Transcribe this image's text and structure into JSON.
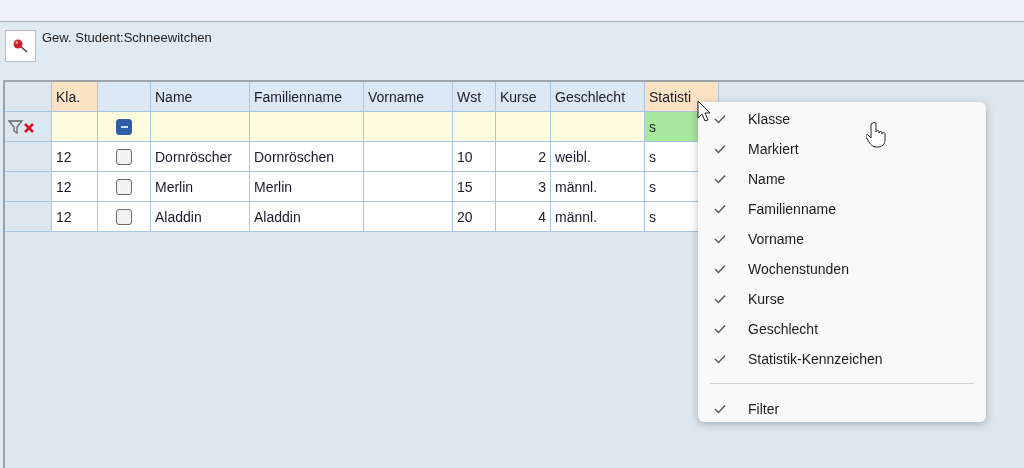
{
  "selection": {
    "label": "Gew. Student:Schneewitchen"
  },
  "table": {
    "columns": [
      {
        "label": "Kla.",
        "sorted": true
      },
      {
        "sorted": false
      },
      {
        "label": "Name",
        "sorted": false
      },
      {
        "label": "Familienname",
        "sorted": false
      },
      {
        "label": "Vorname",
        "sorted": false
      },
      {
        "label": "Wst",
        "sorted": false
      },
      {
        "label": "Kurse",
        "sorted": false
      },
      {
        "label": "Geschlecht",
        "sorted": false
      },
      {
        "label": "Statisti",
        "sorted": true
      }
    ],
    "filter_row": [
      {
        "active": false
      },
      {
        "kind": "checkbox",
        "indeterminate": true
      },
      {
        "active": false
      },
      {
        "active": false
      },
      {
        "active": false
      },
      {
        "active": false
      },
      {
        "active": false
      },
      {
        "active": false
      },
      {
        "value": "s",
        "active": true
      }
    ],
    "rows": [
      {
        "klasse": "12",
        "checked": false,
        "name": "Dornröscher",
        "familienname": "Dornröschen",
        "wst": "10",
        "kurse": "2",
        "geschlecht": "weibl.",
        "statistik": "s"
      },
      {
        "klasse": "12",
        "checked": false,
        "name": "Merlin",
        "familienname": "Merlin",
        "wst": "15",
        "kurse": "3",
        "geschlecht": "männl.",
        "statistik": "s"
      },
      {
        "klasse": "12",
        "checked": false,
        "name": "Aladdin",
        "familienname": "Aladdin",
        "wst": "20",
        "kurse": "4",
        "geschlecht": "männl.",
        "statistik": "s"
      }
    ]
  },
  "context_menu": {
    "items": [
      {
        "label": "Klasse",
        "checked": true
      },
      {
        "label": "Markiert",
        "checked": true
      },
      {
        "label": "Name",
        "checked": true
      },
      {
        "label": "Familienname",
        "checked": true
      },
      {
        "label": "Vorname",
        "checked": true
      },
      {
        "label": "Wochenstunden",
        "checked": true
      },
      {
        "label": "Kurse",
        "checked": true
      },
      {
        "label": "Geschlecht",
        "checked": true
      },
      {
        "label": "Statistik-Kennzeichen",
        "checked": true
      },
      {
        "kind": "separator"
      },
      {
        "label": "Filter",
        "checked": true
      }
    ]
  }
}
